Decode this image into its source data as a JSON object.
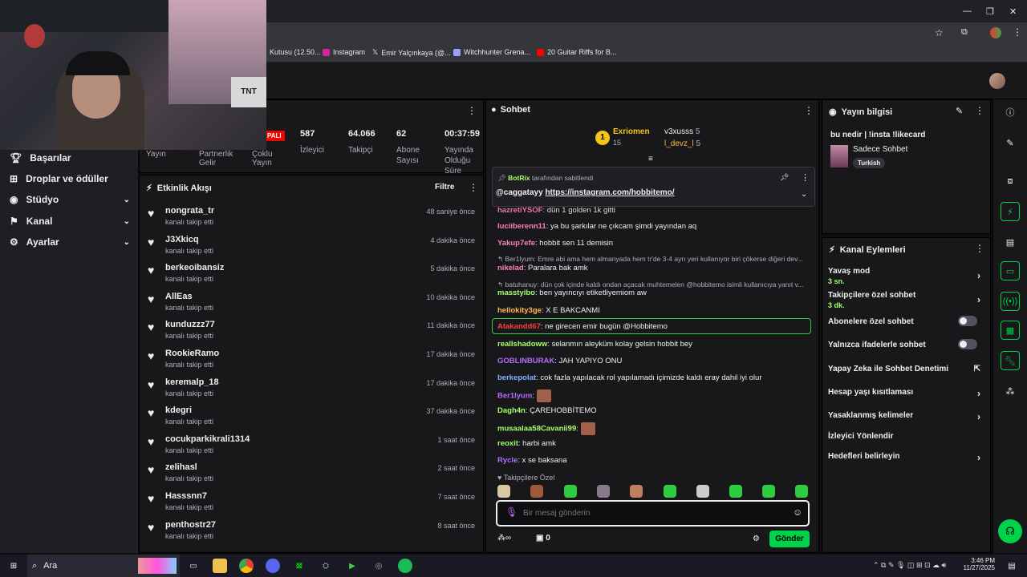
{
  "bookmarks": [
    {
      "label": "Kutusu (12.50...",
      "color": "#5f6368"
    },
    {
      "label": "Instagram",
      "color": "#d6249f"
    },
    {
      "label": "Emir Yalçınkaya (@...",
      "color": "#e8eaed"
    },
    {
      "label": "Witchhunter Grena...",
      "color": "#9aa0ff"
    },
    {
      "label": "20 Guitar Riffs for B...",
      "color": "#ff0000"
    }
  ],
  "webcam": {
    "sign": "TNT"
  },
  "nav": [
    {
      "label": "Başarılar",
      "has_chevron": false
    },
    {
      "label": "Droplar ve ödüller",
      "has_chevron": false
    },
    {
      "label": "Stüdyo",
      "has_chevron": true
    },
    {
      "label": "Kanal",
      "has_chevron": true
    },
    {
      "label": "Ayarlar",
      "has_chevron": true
    }
  ],
  "stats": {
    "live_badge": "PALI",
    "items": [
      {
        "value": "587",
        "label": "İzleyici"
      },
      {
        "value": "64.066",
        "label": "Takipçi"
      },
      {
        "value": "62",
        "label": "Abone Sayısı"
      },
      {
        "value": "00:37:59",
        "label": "Yayında Olduğu Süre"
      }
    ],
    "extra_labels": [
      "Yayın",
      "Partnerlik Gelir",
      "Çoklu Yayın"
    ]
  },
  "activity": {
    "title": "Etkinlik Akışı",
    "filter": "Filtre",
    "rows": [
      {
        "name": "nongrata_tr",
        "action": "kanalı takip etti",
        "time": "48 saniye önce"
      },
      {
        "name": "J3Xkicq",
        "action": "kanalı takip etti",
        "time": "4 dakika önce"
      },
      {
        "name": "berkeoibansiz",
        "action": "kanalı takip etti",
        "time": "5 dakika önce"
      },
      {
        "name": "AllEas",
        "action": "kanalı takip etti",
        "time": "10 dakika önce"
      },
      {
        "name": "kunduzzz77",
        "action": "kanalı takip etti",
        "time": "11 dakika önce"
      },
      {
        "name": "RookieRamo",
        "action": "kanalı takip etti",
        "time": "17 dakika önce"
      },
      {
        "name": "keremalp_18",
        "action": "kanalı takip etti",
        "time": "17 dakika önce"
      },
      {
        "name": "kdegri",
        "action": "kanalı takip etti",
        "time": "37 dakika önce"
      },
      {
        "name": "cocukparkikrali1314",
        "action": "kanalı takip etti",
        "time": "1 saat önce"
      },
      {
        "name": "zelihasl",
        "action": "kanalı takip etti",
        "time": "2 saat önce"
      },
      {
        "name": "Hasssnn7",
        "action": "kanalı takip etti",
        "time": "7 saat önce"
      },
      {
        "name": "penthostr27",
        "action": "kanalı takip etti",
        "time": "8 saat önce"
      }
    ]
  },
  "chat": {
    "title": "Sohbet",
    "leaderboard": {
      "first": {
        "rank": "1",
        "name": "Exriomen",
        "score": "15"
      },
      "second": {
        "name": "v3xusss",
        "score": "5"
      },
      "third": {
        "name": "l_devz_l",
        "score": "5"
      }
    },
    "pinned": {
      "by": "BotRix",
      "by_suffix": "tarafından sabitlendi",
      "user": "@caggatayy",
      "link": "https://instagram.com/hobbitemo/"
    },
    "messages": [
      {
        "user": "hazretiYSOF",
        "text": "dün 1 golden 1k gitti",
        "color": "#ff7fbf",
        "reply": false
      },
      {
        "user": "luciiberenn11",
        "text": "ya bu şarkılar ne çıkcam şimdi yayından aq",
        "color": "#ff7fbf",
        "reply": false
      },
      {
        "user": "Yakup7efe",
        "text": "hobbit sen 11 demisin",
        "color": "#ff7fbf",
        "reply": false
      },
      {
        "user": "",
        "text": "Ber1lyum: Emre abi ama hem almanyada hem tr'de 3-4 ayrı yeri kullanıyor biri çökerse diğeri dev...",
        "color": "#adadb8",
        "reply": true
      },
      {
        "user": "nikelad",
        "text": "Paralara bak amk",
        "color": "#ff7fbf",
        "reply": false
      },
      {
        "user": "",
        "text": "batuhanuy: dün çok içinde kaldı ondan açacak muhtemelen @hobbitemo isimli kullanıcıya yanıt v...",
        "color": "#adadb8",
        "reply": true
      },
      {
        "user": "masstyibo",
        "text": "ben yayıncıyı etiketliyemiom aw",
        "color": "#a4ff6b",
        "reply": false
      },
      {
        "user": "hellokity3ge",
        "text": "X E BAKCANMI",
        "color": "#ffb84d",
        "reply": false
      },
      {
        "user": "Atakandd67",
        "text": "ne girecen emir bugün @Hobbitemo",
        "color": "#ff3b3b",
        "reply": false
      },
      {
        "user": "reallshadoww",
        "text": "selanmın aleyküm kolay gelsin hobbit bey",
        "color": "#a4ff6b",
        "reply": false
      },
      {
        "user": "GOBLINBURAK",
        "text": "JAH YAPIYO ONU",
        "color": "#b36bff",
        "reply": false
      },
      {
        "user": "berkepolat",
        "text": "cok fazla yapılacak rol yapılamadı içimizde kaldı eray dahil iyi olur",
        "color": "#7fb2ff",
        "reply": false
      },
      {
        "user": "Ber1lyum",
        "text": "",
        "color": "#b36bff",
        "reply": false
      },
      {
        "user": "Dagh4n",
        "text": "ÇAREHOBBİTEMO",
        "color": "#a4ff6b",
        "reply": false
      },
      {
        "user": "musaalaa58Cavanii99",
        "text": "",
        "color": "#a4ff6b",
        "reply": false
      },
      {
        "user": "reoxit",
        "text": "harbi amk",
        "color": "#a4ff6b",
        "reply": false
      },
      {
        "user": "Rycle",
        "text": "x se baksana",
        "color": "#b36bff",
        "reply": false
      }
    ],
    "followers_only": "Takipçilere Özel",
    "input_placeholder": "Bir mesaj gönderin",
    "points": "0",
    "send": "Gönder"
  },
  "info": {
    "title": "Yayın bilgisi",
    "stream_title": "bu nedir | !insta !likecard",
    "category": "Sadece Sohbet",
    "tag": "Turkish"
  },
  "channel_actions": {
    "title": "Kanal Eylemleri",
    "items": [
      {
        "label": "Yavaş mod",
        "sub": "3 sn.",
        "control": "arrow"
      },
      {
        "label": "Takipçilere özel sohbet",
        "sub": "3 dk.",
        "control": "arrow"
      },
      {
        "label": "Abonelere özel sohbet",
        "sub": "",
        "control": "toggle"
      },
      {
        "label": "Yalnızca ifadelerle sohbet",
        "sub": "",
        "control": "toggle"
      },
      {
        "label": "Yapay Zeka ile Sohbet Denetimi",
        "sub": "",
        "control": "external"
      },
      {
        "label": "Hesap yaşı kısıtlaması",
        "sub": "",
        "control": "arrow"
      },
      {
        "label": "Yasaklanmış kelimeler",
        "sub": "",
        "control": "arrow"
      },
      {
        "label": "İzleyici Yönlendir",
        "sub": "",
        "control": "none"
      },
      {
        "label": "Hedefleri belirleyin",
        "sub": "",
        "control": "arrow"
      }
    ]
  },
  "taskbar": {
    "search": "Ara",
    "time": "3:46 PM",
    "date": "11/27/2025"
  },
  "colors": {
    "accent": "#00d24a",
    "bg": "#0e0e10",
    "panel": "#18181b"
  }
}
